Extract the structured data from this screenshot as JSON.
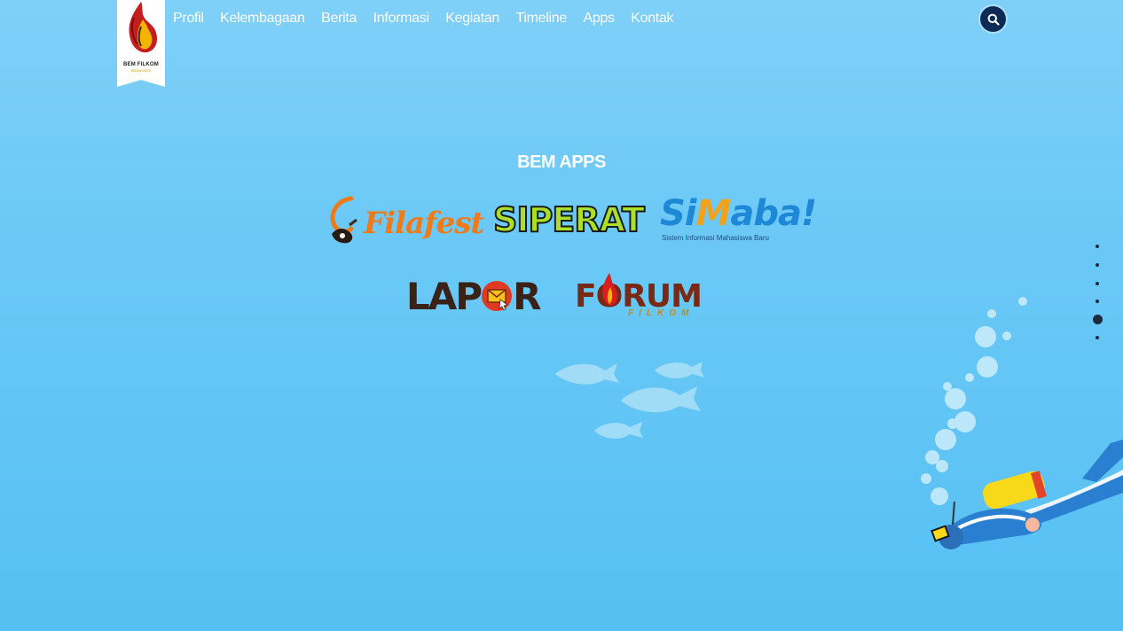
{
  "logo": {
    "title": "BEM FILKOM",
    "subtitle": "BRAWIJAYA"
  },
  "nav": {
    "items": [
      "Profil",
      "Kelembagaan",
      "Berita",
      "Informasi",
      "Kegiatan",
      "Timeline",
      "Apps",
      "Kontak"
    ]
  },
  "search": {
    "icon": "search-icon"
  },
  "section": {
    "title": "BEM APPS"
  },
  "apps": {
    "filafest": "Filafest",
    "siperat": "SIPERAT",
    "simaba_si": "Si",
    "simaba_m": "M",
    "simaba_rest": "aba!",
    "simaba_sub": "Sistem Informasi Mahasiswa Baru",
    "lapor_a": "LAP",
    "lapor_b": "R",
    "forum": "FORUM",
    "forum_sub": "FILKOM"
  },
  "slides": {
    "count": 6,
    "active_index": 4
  },
  "colors": {
    "accent_dark": "#0d2b55",
    "bg_top": "#7fd0f8",
    "bg_bottom": "#55c0f3"
  }
}
